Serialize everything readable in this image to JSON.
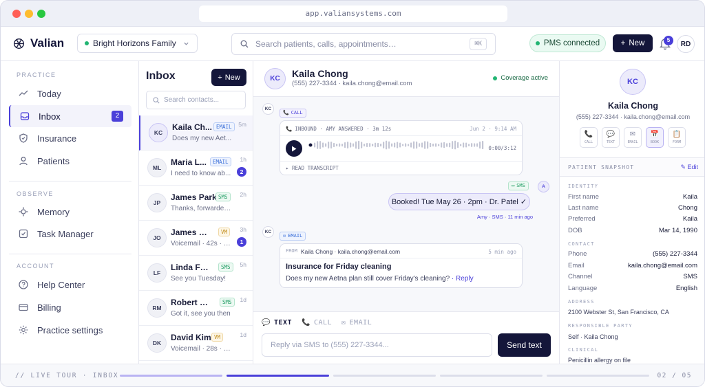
{
  "browser": {
    "url": "app.valiansystems.com"
  },
  "topbar": {
    "brand": "Valian",
    "practice": "Bright Horizons Family",
    "search_placeholder": "Search patients, calls, appointments…",
    "search_shortcut": "⌘K",
    "pms_status": "PMS connected",
    "new_label": "New",
    "notification_count": "5",
    "user_initials": "RD"
  },
  "sidebar": {
    "sections": [
      {
        "title": "PRACTICE",
        "items": [
          {
            "label": "Today",
            "icon": "trend-icon"
          },
          {
            "label": "Inbox",
            "icon": "inbox-icon",
            "count": "2",
            "active": true
          },
          {
            "label": "Insurance",
            "icon": "shield-icon"
          },
          {
            "label": "Patients",
            "icon": "person-icon"
          }
        ]
      },
      {
        "title": "OBSERVE",
        "items": [
          {
            "label": "Memory",
            "icon": "memory-icon"
          },
          {
            "label": "Task Manager",
            "icon": "checkbox-icon"
          }
        ]
      },
      {
        "title": "ACCOUNT",
        "items": [
          {
            "label": "Help Center",
            "icon": "help-icon"
          },
          {
            "label": "Billing",
            "icon": "card-icon"
          },
          {
            "label": "Practice settings",
            "icon": "gear-icon"
          }
        ]
      }
    ]
  },
  "inbox": {
    "title": "Inbox",
    "new_label": "New",
    "search_placeholder": "Search contacts...",
    "rows": [
      {
        "initials": "KC",
        "name": "Kaila Ch...",
        "channel": "EMAIL",
        "time": "5m",
        "preview": "Does my new Aet...",
        "unread": ""
      },
      {
        "initials": "ML",
        "name": "Maria L...",
        "channel": "EMAIL",
        "time": "1h",
        "preview": "I need to know ab...",
        "unread": "2"
      },
      {
        "initials": "JP",
        "name": "James Park",
        "channel": "SMS",
        "time": "2h",
        "preview": "Thanks, forwarded...",
        "unread": ""
      },
      {
        "initials": "JO",
        "name": "James O'C...",
        "channel": "VM",
        "time": "3h",
        "preview": "Voicemail · 42s · cr...",
        "unread": "1"
      },
      {
        "initials": "LF",
        "name": "Linda Fost...",
        "channel": "SMS",
        "time": "5h",
        "preview": "See you Tuesday!",
        "unread": ""
      },
      {
        "initials": "RM",
        "name": "Robert Ma...",
        "channel": "SMS",
        "time": "1d",
        "preview": "Got it, see you then",
        "unread": ""
      },
      {
        "initials": "DK",
        "name": "David Kim",
        "channel": "VM",
        "time": "1d",
        "preview": "Voicemail · 28s · re: ...",
        "unread": ""
      }
    ]
  },
  "conversation": {
    "initials": "KC",
    "name": "Kaila Chong",
    "contact": "(555) 227-3344 · kaila.chong@email.com",
    "coverage": "Coverage active",
    "call": {
      "chip": "CALL",
      "header": "INBOUND · AMY ANSWERED · 3m 12s",
      "date": "Jun 2 · 9:14 AM",
      "duration": "0:00/3:12",
      "transcript_link": "▸ READ TRANSCRIPT"
    },
    "sms": {
      "chip": "SMS",
      "avatar": "A",
      "text": "Booked! Tue May 26 · 2pm · Dr. Patel ✓",
      "meta": "Amy · SMS · 11 min ago"
    },
    "email": {
      "chip": "EMAIL",
      "from_label": "FROM",
      "from": "Kaila Chong · kaila.chong@email.com",
      "time": "5 min ago",
      "subject": "Insurance for Friday cleaning",
      "body": "Does my new Aetna plan still cover Friday's cleaning?",
      "reply": "· Reply"
    },
    "compose": {
      "tabs": [
        "TEXT",
        "CALL",
        "EMAIL"
      ],
      "placeholder": "Reply via SMS to (555) 227-3344...",
      "send_label": "Send text"
    }
  },
  "patient": {
    "initials": "KC",
    "name": "Kaila Chong",
    "contact": "(555) 227-3344 · kaila.chong@email.com",
    "actions": [
      "CALL",
      "TEXT",
      "EMAIL",
      "BOOK",
      "FORM"
    ],
    "snapshot_title": "PATIENT SNAPSHOT",
    "edit_label": "✎ Edit",
    "identity_title": "IDENTITY",
    "identity": [
      {
        "k": "First name",
        "v": "Kaila"
      },
      {
        "k": "Last name",
        "v": "Chong"
      },
      {
        "k": "Preferred",
        "v": "Kaila"
      },
      {
        "k": "DOB",
        "v": "Mar 14, 1990"
      }
    ],
    "contact_title": "CONTACT",
    "contact_rows": [
      {
        "k": "Phone",
        "v": "(555) 227-3344"
      },
      {
        "k": "Email",
        "v": "kaila.chong@email.com"
      },
      {
        "k": "Channel",
        "v": "SMS"
      },
      {
        "k": "Language",
        "v": "English"
      }
    ],
    "address_title": "ADDRESS",
    "address": "2100 Webster St, San Francisco, CA",
    "responsible_title": "RESPONSIBLE PARTY",
    "responsible": "Self · Kaila Chong",
    "clinical_title": "CLINICAL",
    "clinical": "Penicillin allergy on file"
  },
  "footer": {
    "label": "// LIVE TOUR · INBOX",
    "page": "02 / 05",
    "steps": 5,
    "current_step": 2
  },
  "colors": {
    "accent": "#4a3fd9",
    "navy": "#14163a",
    "green": "#22b573"
  }
}
